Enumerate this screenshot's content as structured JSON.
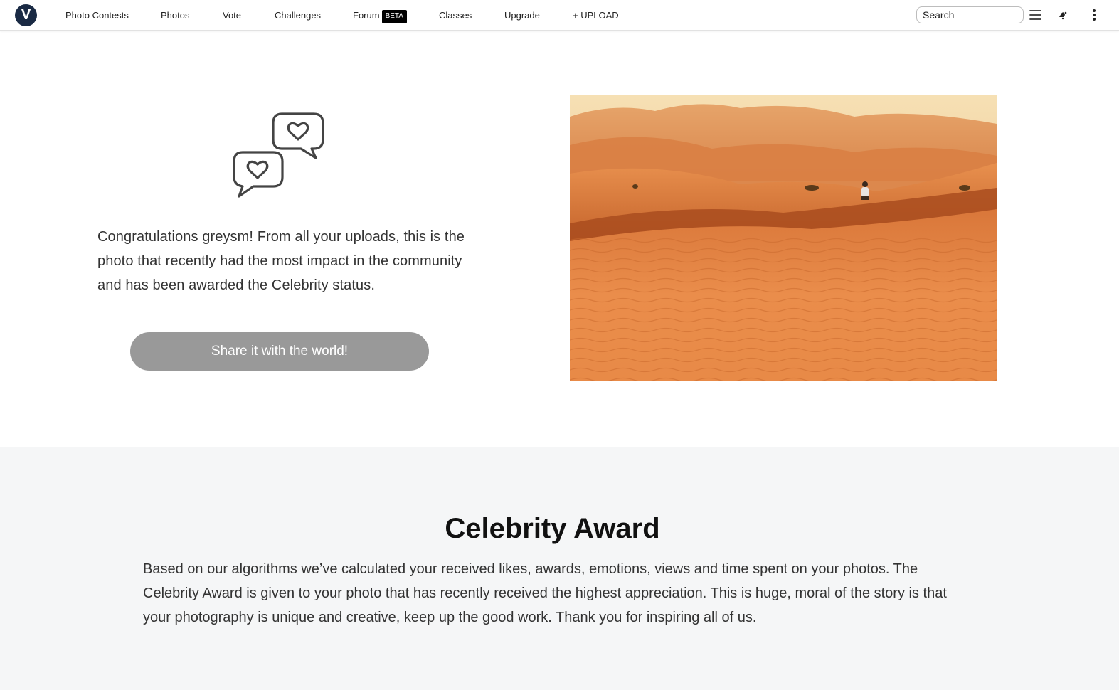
{
  "nav": {
    "logo_letter": "V",
    "items": [
      {
        "label": "Photo Contests"
      },
      {
        "label": "Photos"
      },
      {
        "label": "Vote"
      },
      {
        "label": "Challenges"
      },
      {
        "label": "Forum",
        "badge": "BETA"
      },
      {
        "label": "Classes"
      },
      {
        "label": "Upgrade"
      },
      {
        "label": "+ UPLOAD"
      }
    ],
    "search_placeholder": "Search",
    "icons": [
      "menu-icon",
      "notification-icon",
      "more-vertical-icon"
    ]
  },
  "hero": {
    "icon": "heart-speech-bubbles-icon",
    "message": "Congratulations greysm! From all your uploads, this is the photo that recently had the most impact in the community and has been awarded the Celebrity status.",
    "share_button": "Share it with the world!",
    "photo_subject": "desert dunes with a person sitting"
  },
  "award": {
    "title": "Celebrity Award",
    "description": "Based on our algorithms we’ve calculated your received likes, awards, emotions, views and time spent on your photos. The Celebrity Award is given to your photo that has recently received the highest appreciation. This is huge, moral of the story is that your photography is unique and creative, keep up the good work. Thank you for inspiring all of us."
  },
  "colors": {
    "logo": "#1a2a44",
    "button": "#999999",
    "award_bg": "#f5f6f7",
    "sand": "#e07a32"
  }
}
